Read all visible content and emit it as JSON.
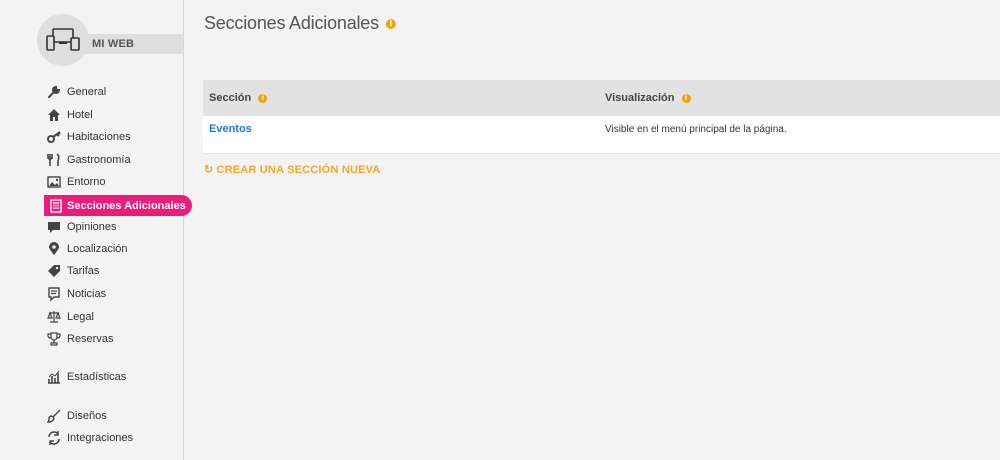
{
  "sidebar": {
    "brand_label": "MI WEB",
    "brand_icon": "devices-icon",
    "items": [
      {
        "label": "General",
        "icon": "wrench-icon"
      },
      {
        "label": "Hotel",
        "icon": "house-icon"
      },
      {
        "label": "Habitaciones",
        "icon": "key-icon"
      },
      {
        "label": "Gastronomía",
        "icon": "fork-knife-icon"
      },
      {
        "label": "Entorno",
        "icon": "picture-icon"
      },
      {
        "label": "Secciones Adicionales",
        "icon": "document-icon"
      },
      {
        "label": "Opiniones",
        "icon": "chat-bubble-icon"
      },
      {
        "label": "Localización",
        "icon": "map-pin-icon"
      },
      {
        "label": "Tarifas",
        "icon": "price-tag-icon"
      },
      {
        "label": "Noticias",
        "icon": "news-icon"
      },
      {
        "label": "Legal",
        "icon": "scales-icon"
      },
      {
        "label": "Reservas",
        "icon": "trophy-icon"
      },
      {
        "label": "Estadísticas",
        "icon": "bar-chart-icon"
      },
      {
        "label": "Diseños",
        "icon": "brush-icon"
      },
      {
        "label": "Integraciones",
        "icon": "sync-icon"
      }
    ],
    "active_index": 5
  },
  "main": {
    "title": "Secciones Adicionales",
    "info_glyph": "i",
    "table": {
      "columns": [
        "Sección",
        "Visualización"
      ],
      "rows": [
        {
          "seccion": "Eventos",
          "visualizacion": "Visible en el menú principal de la página."
        }
      ]
    },
    "create_label": "CREAR UNA SECCIÓN NUEVA",
    "create_icon_glyph": "↻"
  },
  "colors": {
    "accent_pink": "#ec1c7a",
    "accent_orange": "#f5a623",
    "link_blue": "#1a7bd0"
  }
}
